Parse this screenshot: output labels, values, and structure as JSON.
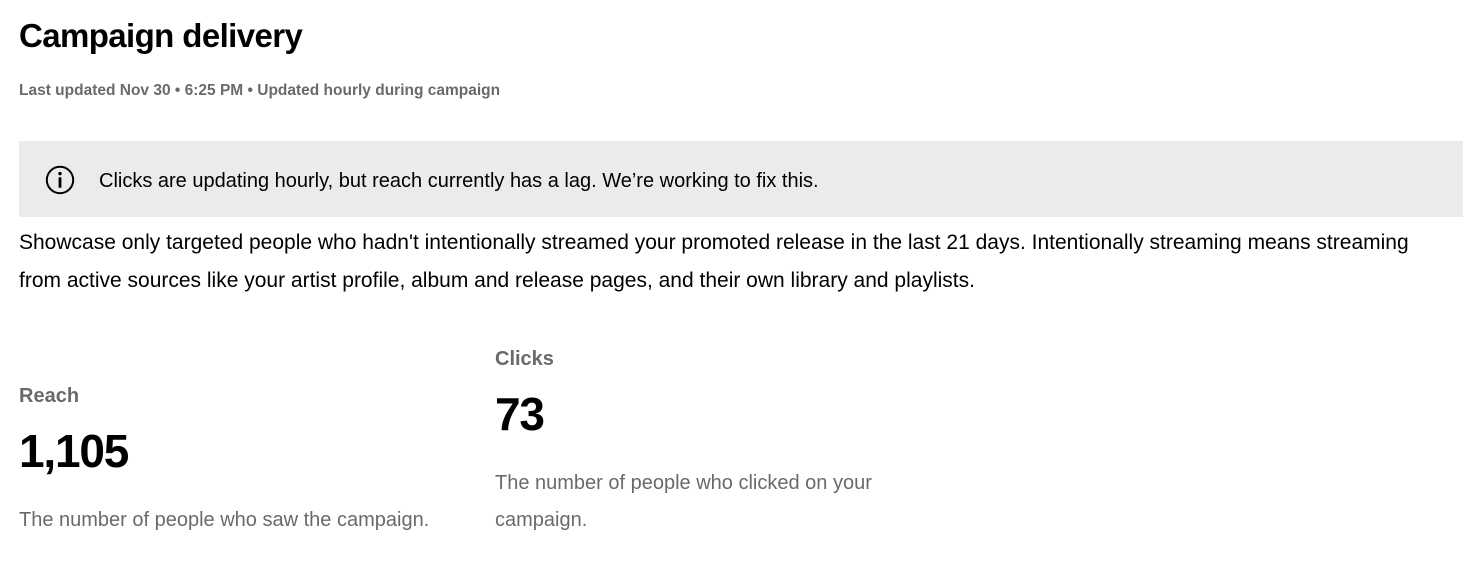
{
  "header": {
    "title": "Campaign delivery",
    "last_updated": "Last updated Nov 30 • 6:25 PM • Updated hourly during campaign"
  },
  "banner": {
    "icon": "info-icon",
    "message": "Clicks are updating hourly, but reach currently has a lag. We’re working to fix this."
  },
  "description": "Showcase only targeted people who hadn't intentionally streamed your promoted release in the last 21 days. Intentionally streaming means streaming from active sources like your artist profile, album and release pages, and their own library and playlists.",
  "metrics": {
    "reach": {
      "label": "Reach",
      "value": "1,105",
      "description": "The number of people who saw the campaign."
    },
    "clicks": {
      "label": "Clicks",
      "value": "73",
      "description": "The number of people who clicked on your campaign."
    }
  }
}
